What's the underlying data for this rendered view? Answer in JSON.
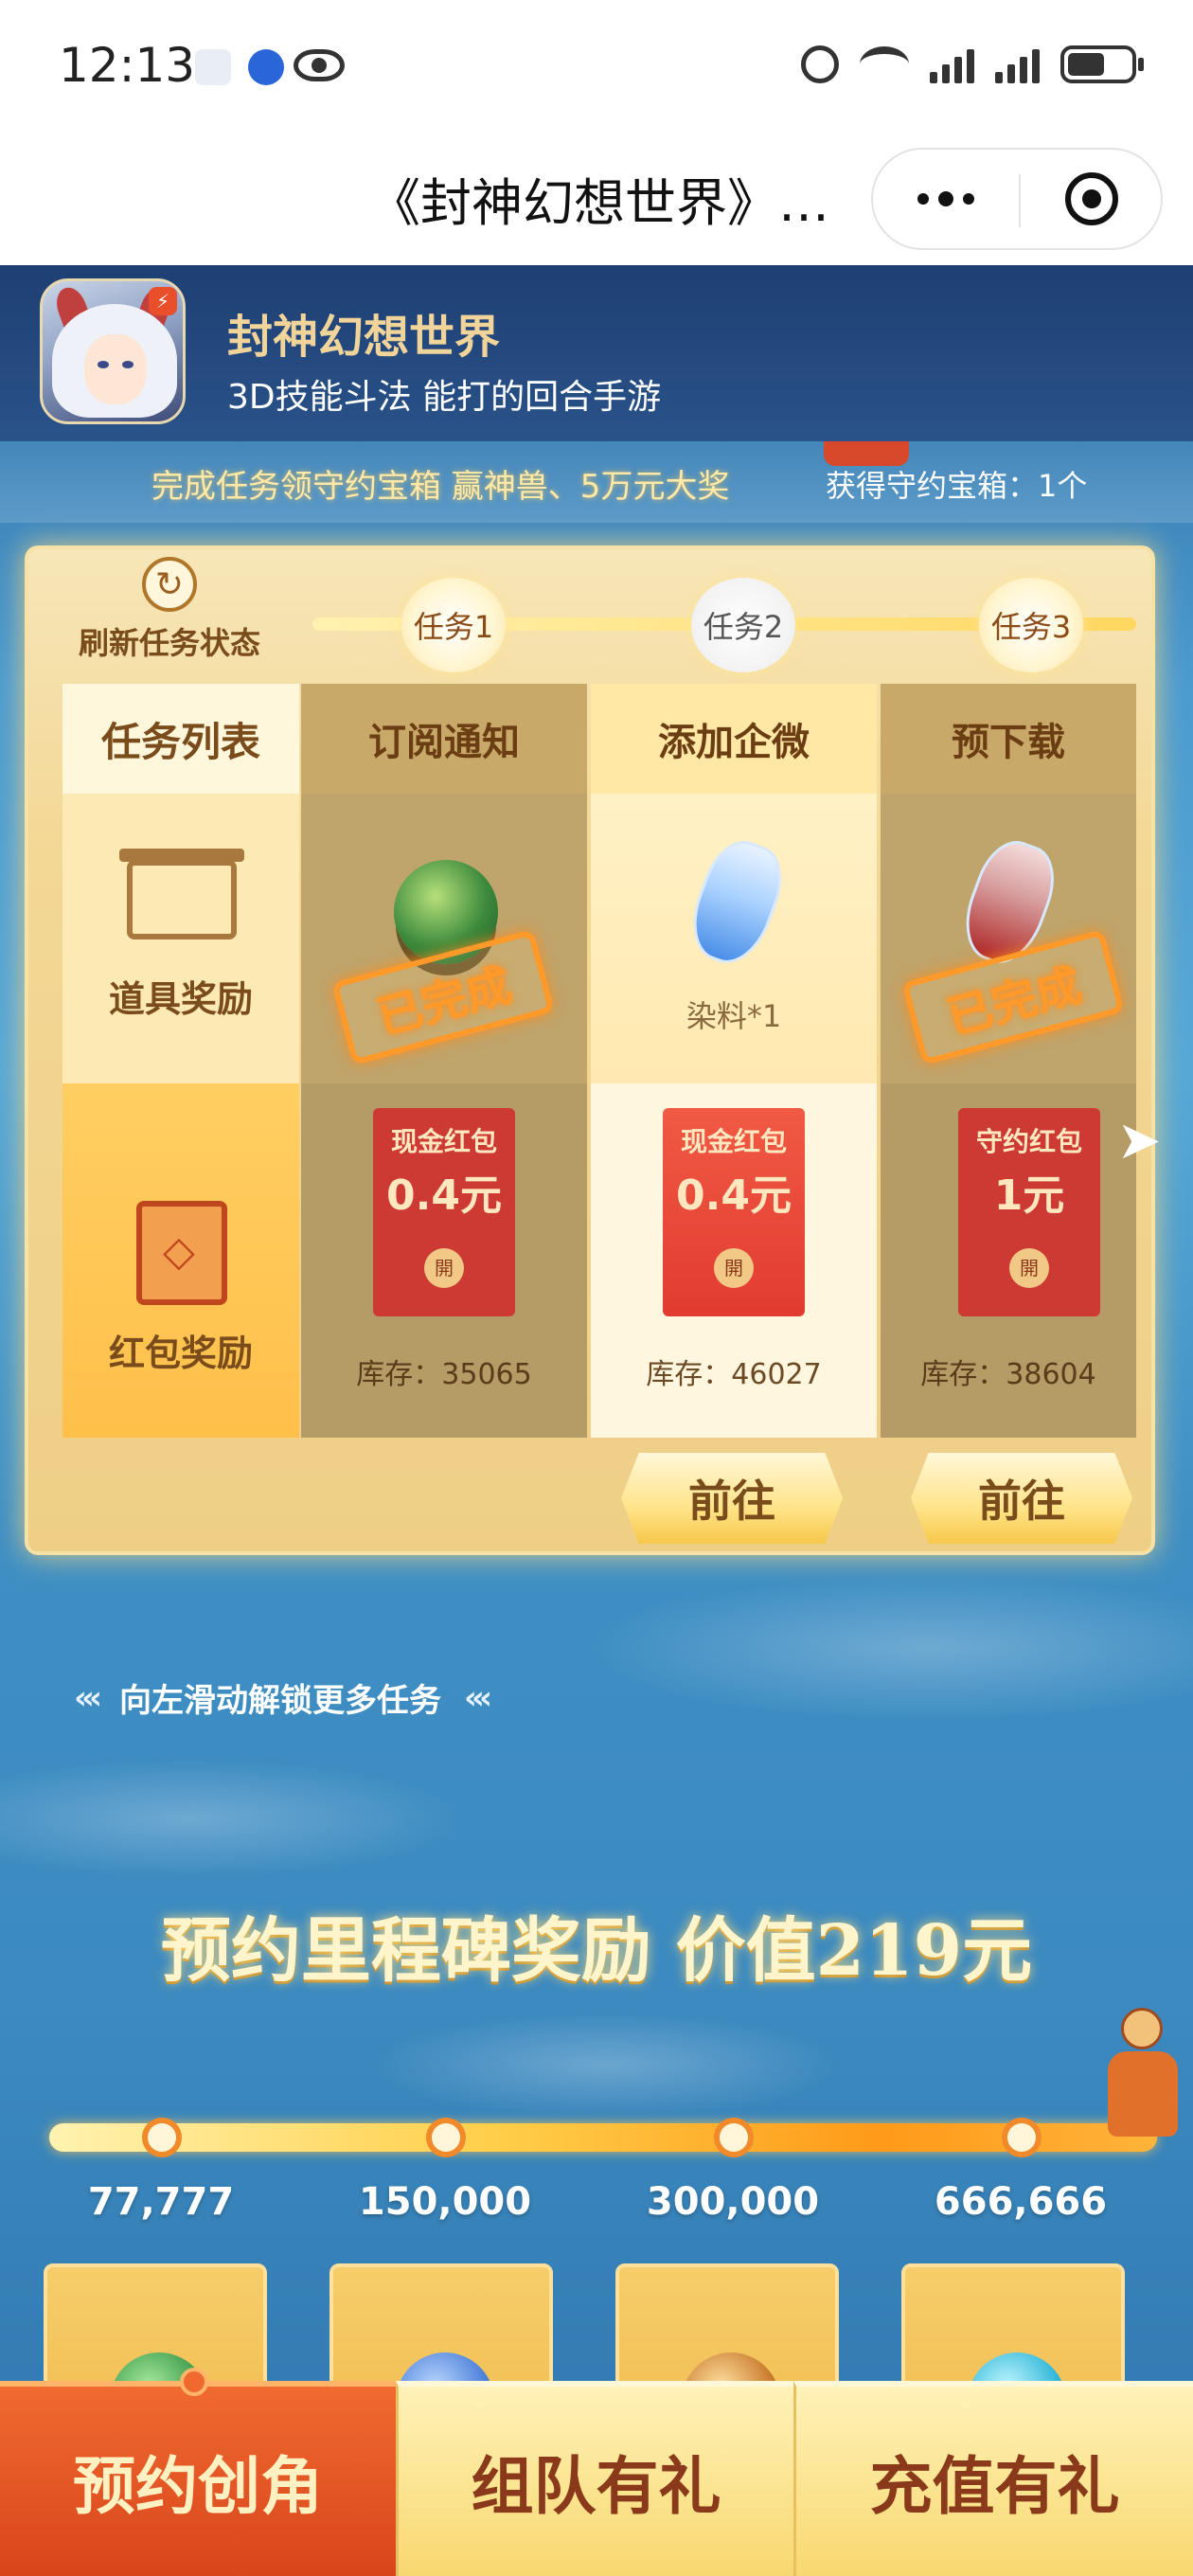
{
  "status_bar": {
    "time": "12:13",
    "icons": [
      "qq-icon",
      "vpn-icon",
      "eye-icon",
      "alarm-icon",
      "wifi-icon",
      "signal-icon",
      "signal-icon",
      "battery-icon"
    ]
  },
  "title_bar": {
    "title": "《封神幻想世界》…",
    "more_icon": "more-dots-icon",
    "close_icon": "target-close-icon"
  },
  "game_header": {
    "app_name": "封神幻想世界",
    "app_desc": "3D技能斗法 能打的回合手游"
  },
  "subtitle": {
    "left": "完成任务领守约宝箱 赢神兽、5万元大奖",
    "right": "获得守约宝箱：1个"
  },
  "task_panel": {
    "refresh_label": "刷新任务状态",
    "nodes": [
      "任务1",
      "任务2",
      "任务3"
    ],
    "left_column": {
      "header": "任务列表",
      "row1_label": "道具奖励",
      "row2_label": "红包奖励"
    },
    "tasks": [
      {
        "title": "订阅通知",
        "prize": "",
        "completed": true,
        "stamp": "已完成",
        "packet_title": "现金红包",
        "packet_amount": "0.4元",
        "packet_btn": "開",
        "stock": "库存：35065"
      },
      {
        "title": "添加企微",
        "prize": "染料*1",
        "completed": false,
        "stamp": "",
        "packet_title": "现金红包",
        "packet_amount": "0.4元",
        "packet_btn": "開",
        "stock": "库存：46027"
      },
      {
        "title": "预下载",
        "prize": "",
        "completed": true,
        "stamp": "已完成",
        "packet_title": "守约红包",
        "packet_amount": "1元",
        "packet_btn": "開",
        "stock": "库存：38604"
      }
    ],
    "goto_buttons": [
      "前往",
      "前往"
    ]
  },
  "swipe_hint": "向左滑动解锁更多任务",
  "milestone": {
    "title": "预约里程碑奖励 价值219元",
    "counts": [
      "77,777",
      "150,000",
      "300,000",
      "666,666"
    ]
  },
  "tabs": [
    {
      "label": "预约创角",
      "active": true
    },
    {
      "label": "组队有礼",
      "active": false
    },
    {
      "label": "充值有礼",
      "active": false
    }
  ],
  "colors": {
    "accent_orange": "#f06a30",
    "gold": "#ffe48a",
    "page_blue": "#4c9bcf",
    "stamp_orange": "#ff9a2a"
  }
}
